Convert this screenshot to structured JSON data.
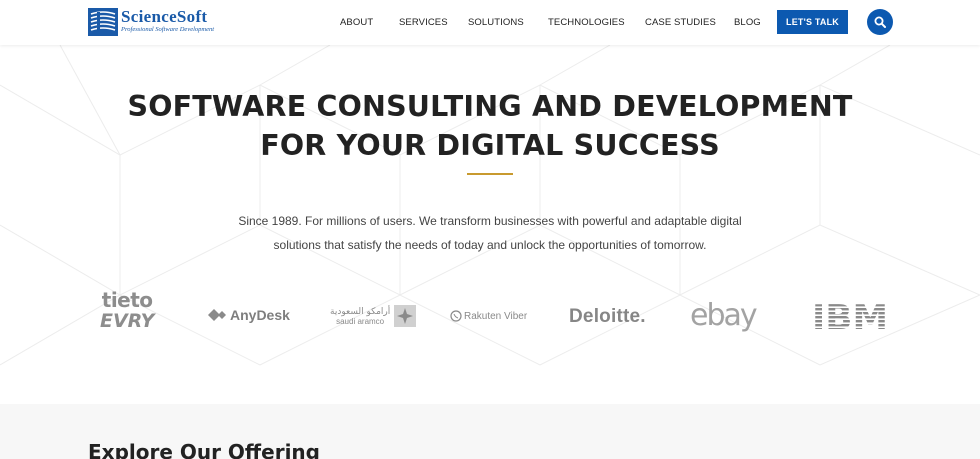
{
  "brand": {
    "name": "ScienceSoft",
    "tagline": "Professional Software Development",
    "color": "#1a5aa8"
  },
  "nav": {
    "items": [
      {
        "label": "ABOUT"
      },
      {
        "label": "SERVICES"
      },
      {
        "label": "SOLUTIONS"
      },
      {
        "label": "TECHNOLOGIES"
      },
      {
        "label": "CASE STUDIES"
      },
      {
        "label": "BLOG"
      }
    ],
    "cta_label": "LET'S TALK",
    "search_icon": "search-icon",
    "accent": "#0c59b0"
  },
  "hero": {
    "title_line1": "SOFTWARE CONSULTING AND DEVELOPMENT",
    "title_line2": "FOR YOUR DIGITAL SUCCESS",
    "divider_color": "#c89a2f",
    "subtitle_line1": "Since 1989. For millions of users. We transform businesses with powerful and adaptable digital",
    "subtitle_line2": "solutions that satisfy the needs of today and unlock the opportunities of tomorrow."
  },
  "clients": [
    {
      "name": "tieto",
      "name2": "EVRY"
    },
    {
      "name": "AnyDesk"
    },
    {
      "name": "أرامكو السعودية",
      "name2": "saudi aramco"
    },
    {
      "name": "Rakuten Viber"
    },
    {
      "name": "Deloitte."
    },
    {
      "name": "ebay"
    },
    {
      "name": "IBM"
    }
  ],
  "offering": {
    "title": "Explore Our Offering"
  }
}
